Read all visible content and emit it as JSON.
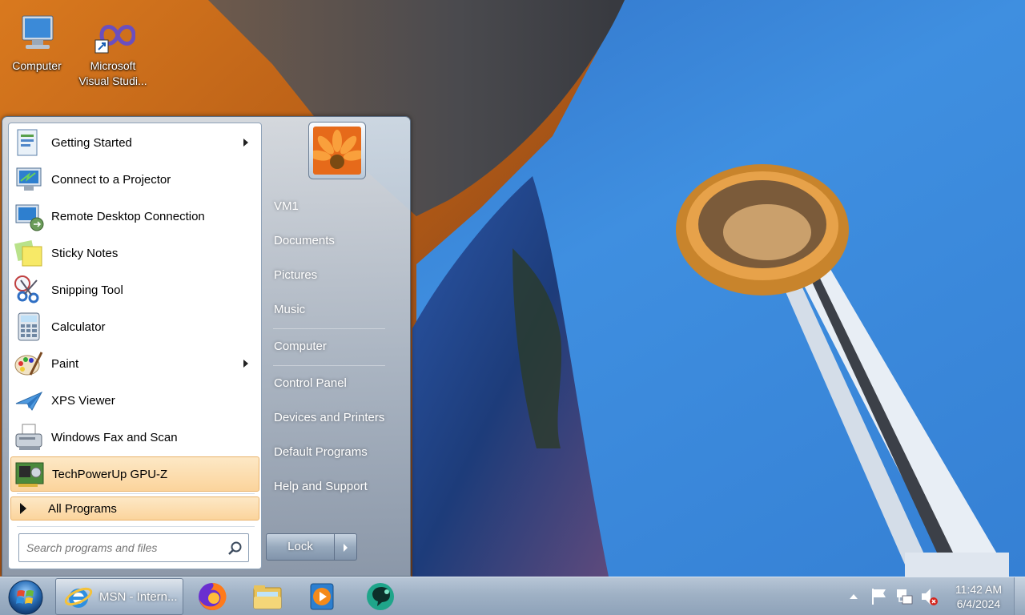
{
  "desktop": {
    "icons": [
      {
        "label": "Computer",
        "icon": "computer-icon"
      },
      {
        "label": "Microsoft Visual Studi...",
        "icon": "visual-studio-icon"
      }
    ]
  },
  "start_menu": {
    "programs": [
      {
        "label": "Getting Started",
        "icon": "getting-started-icon",
        "submenu": true
      },
      {
        "label": "Connect to a Projector",
        "icon": "projector-icon",
        "submenu": false
      },
      {
        "label": "Remote Desktop Connection",
        "icon": "remote-desktop-icon",
        "submenu": false
      },
      {
        "label": "Sticky Notes",
        "icon": "sticky-notes-icon",
        "submenu": false
      },
      {
        "label": "Snipping Tool",
        "icon": "snipping-tool-icon",
        "submenu": false
      },
      {
        "label": "Calculator",
        "icon": "calculator-icon",
        "submenu": false
      },
      {
        "label": "Paint",
        "icon": "paint-icon",
        "submenu": true
      },
      {
        "label": "XPS Viewer",
        "icon": "xps-viewer-icon",
        "submenu": false
      },
      {
        "label": "Windows Fax and Scan",
        "icon": "fax-scan-icon",
        "submenu": false
      },
      {
        "label": "TechPowerUp GPU-Z",
        "icon": "gpu-z-icon",
        "submenu": false,
        "highlighted": true
      }
    ],
    "all_programs": "All Programs",
    "search_placeholder": "Search programs and files",
    "user_name": "VM1",
    "right_items": [
      "Documents",
      "Pictures",
      "Music",
      "Computer",
      "Control Panel",
      "Devices and Printers",
      "Default Programs",
      "Help and Support"
    ],
    "lock_label": "Lock"
  },
  "taskbar": {
    "active_window": "MSN - Intern...",
    "pinned": [
      "firefox-icon",
      "file-explorer-icon",
      "media-player-icon",
      "chat-app-icon"
    ],
    "tray_icons": [
      "show-hidden-icons-icon",
      "action-center-flag-icon",
      "network-icon",
      "volume-muted-icon"
    ],
    "time": "11:42 AM",
    "date": "6/4/2024"
  },
  "colors": {
    "highlight": "#fbd49c",
    "taskbar": "#9fb1c5",
    "sky": "#3b86db"
  }
}
